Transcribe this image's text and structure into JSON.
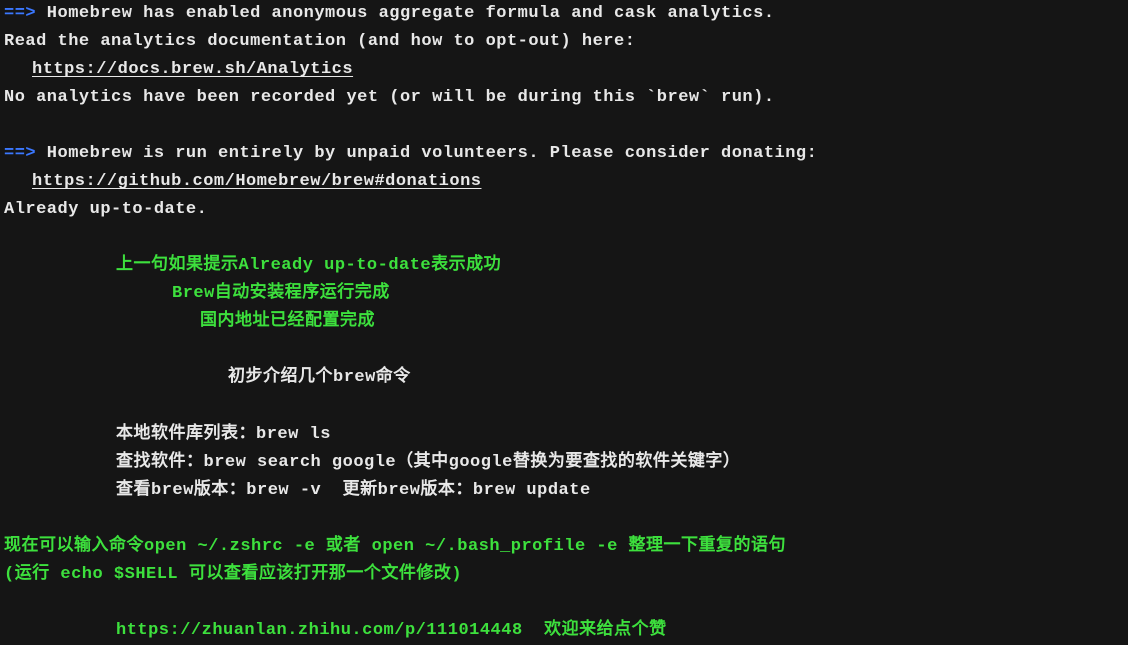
{
  "line1": {
    "arrow": "==>",
    "text": " Homebrew has enabled anonymous aggregate formula and cask analytics."
  },
  "line2": "Read the analytics documentation (and how to opt-out) here:",
  "line3_link": "https://docs.brew.sh/Analytics",
  "line4": "No analytics have been recorded yet (or will be during this `brew` run).",
  "line5": {
    "arrow": "==>",
    "text": " Homebrew is run entirely by unpaid volunteers. Please consider donating:"
  },
  "line6_link": "https://github.com/Homebrew/brew#donations",
  "line7": "Already up-to-date.",
  "line8": "上一句如果提示Already up-to-date表示成功",
  "line9": "Brew自动安装程序运行完成",
  "line10": "国内地址已经配置完成",
  "line11": "初步介绍几个brew命令",
  "line12": "本地软件库列表：brew ls",
  "line13": "查找软件：brew search google（其中google替换为要查找的软件关键字）",
  "line14": "查看brew版本：brew -v  更新brew版本：brew update",
  "line15": "现在可以输入命令open ~/.zshrc -e 或者 open ~/.bash_profile -e 整理一下重复的语句",
  "line16": "(运行 echo $SHELL 可以查看应该打开那一个文件修改)",
  "line17_link": "https://zhuanlan.zhihu.com/p/111014448",
  "line17_text": "  欢迎来给点个赞"
}
